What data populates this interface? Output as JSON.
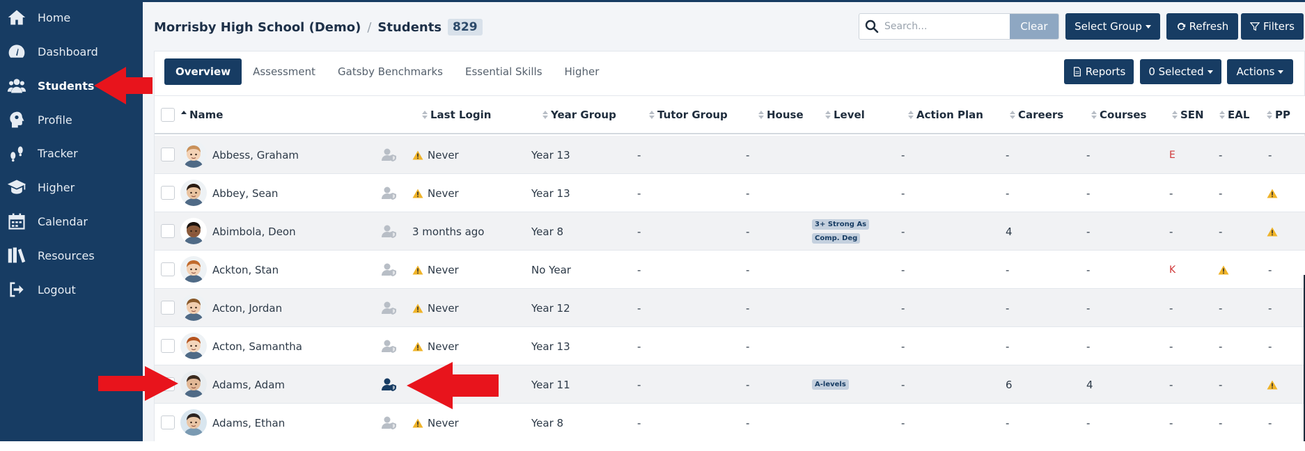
{
  "sidebar": {
    "items": [
      {
        "label": "Home",
        "icon": "home-icon"
      },
      {
        "label": "Dashboard",
        "icon": "dashboard-icon"
      },
      {
        "label": "Students",
        "icon": "students-icon",
        "active": true
      },
      {
        "label": "Profile",
        "icon": "profile-icon"
      },
      {
        "label": "Tracker",
        "icon": "tracker-icon"
      },
      {
        "label": "Higher",
        "icon": "graduation-cap-icon"
      },
      {
        "label": "Calendar",
        "icon": "calendar-icon"
      },
      {
        "label": "Resources",
        "icon": "books-icon"
      },
      {
        "label": "Logout",
        "icon": "logout-icon"
      }
    ]
  },
  "header": {
    "school": "Morrisby High School (Demo)",
    "separator": "/",
    "page": "Students",
    "count": "829"
  },
  "search": {
    "placeholder": "Search...",
    "clear_label": "Clear"
  },
  "toolbar": {
    "select_group_label": "Select Group",
    "refresh_label": "Refresh",
    "filters_label": "Filters"
  },
  "tabs": [
    {
      "label": "Overview",
      "active": true
    },
    {
      "label": "Assessment"
    },
    {
      "label": "Gatsby Benchmarks"
    },
    {
      "label": "Essential Skills"
    },
    {
      "label": "Higher"
    }
  ],
  "tab_actions": {
    "reports_label": "Reports",
    "selected_label": "0 Selected",
    "actions_label": "Actions"
  },
  "table": {
    "columns": [
      "Name",
      "Last Login",
      "Year Group",
      "Tutor Group",
      "House",
      "Level",
      "Action Plan",
      "Careers",
      "Courses",
      "SEN",
      "EAL",
      "PP"
    ],
    "rows": [
      {
        "name": "Abbess, Graham",
        "last_login": "Never",
        "login_warn": true,
        "year": "Year 13",
        "tutor": "-",
        "house": "-",
        "level": [],
        "action_plan": "-",
        "careers": "-",
        "courses": "-",
        "sen": "E",
        "eal": "-",
        "pp": "-",
        "pp_warn": false,
        "eal_warn": false,
        "user_active": false
      },
      {
        "name": "Abbey, Sean",
        "last_login": "Never",
        "login_warn": true,
        "year": "Year 13",
        "tutor": "-",
        "house": "-",
        "level": [],
        "action_plan": "-",
        "careers": "-",
        "courses": "-",
        "sen": "-",
        "eal": "-",
        "pp": "",
        "pp_warn": true,
        "eal_warn": false,
        "user_active": false
      },
      {
        "name": "Abimbola, Deon",
        "last_login": "3 months ago",
        "login_warn": false,
        "year": "Year 8",
        "tutor": "-",
        "house": "-",
        "level": [
          "3+ Strong As",
          "Comp. Deg"
        ],
        "action_plan": "-",
        "careers": "4",
        "courses": "-",
        "sen": "-",
        "eal": "-",
        "pp": "",
        "pp_warn": true,
        "eal_warn": false,
        "user_active": false
      },
      {
        "name": "Ackton, Stan",
        "last_login": "Never",
        "login_warn": true,
        "year": "No Year",
        "tutor": "-",
        "house": "-",
        "level": [],
        "action_plan": "-",
        "careers": "-",
        "courses": "-",
        "sen": "K",
        "eal": "",
        "pp": "-",
        "pp_warn": false,
        "eal_warn": true,
        "user_active": false
      },
      {
        "name": "Acton, Jordan",
        "last_login": "Never",
        "login_warn": true,
        "year": "Year 12",
        "tutor": "-",
        "house": "-",
        "level": [],
        "action_plan": "-",
        "careers": "-",
        "courses": "-",
        "sen": "-",
        "eal": "-",
        "pp": "-",
        "pp_warn": false,
        "eal_warn": false,
        "user_active": false
      },
      {
        "name": "Acton, Samantha",
        "last_login": "Never",
        "login_warn": true,
        "year": "Year 13",
        "tutor": "-",
        "house": "-",
        "level": [],
        "action_plan": "-",
        "careers": "-",
        "courses": "-",
        "sen": "-",
        "eal": "-",
        "pp": "-",
        "pp_warn": false,
        "eal_warn": false,
        "user_active": false
      },
      {
        "name": "Adams, Adam",
        "last_login": "",
        "login_warn": false,
        "year": "Year 11",
        "tutor": "-",
        "house": "-",
        "level": [
          "A-levels"
        ],
        "action_plan": "-",
        "careers": "6",
        "courses": "4",
        "sen": "-",
        "eal": "-",
        "pp": "",
        "pp_warn": true,
        "eal_warn": false,
        "user_active": true
      },
      {
        "name": "Adams, Ethan",
        "last_login": "Never",
        "login_warn": true,
        "year": "Year 8",
        "tutor": "-",
        "house": "-",
        "level": [],
        "action_plan": "-",
        "careers": "-",
        "courses": "-",
        "sen": "-",
        "eal": "-",
        "pp": "-",
        "pp_warn": false,
        "eal_warn": false,
        "user_active": false
      }
    ]
  },
  "colors": {
    "sidebar_bg": "#173c63",
    "primary_button": "#173c63",
    "clear_button": "#8ea7c2",
    "warning": "#f0b429",
    "sen_red": "#d0393a",
    "annotation_arrow": "#e8141c"
  }
}
